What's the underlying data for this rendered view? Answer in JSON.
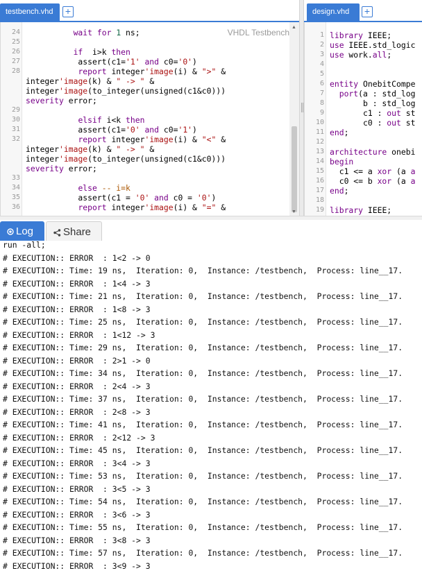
{
  "left_pane": {
    "tab_label": "testbench.vhd",
    "add_tab_symbol": "+",
    "file_label": "VHDL Testbench",
    "lines": [
      {
        "n": "24",
        "segments": [
          [
            "",
            "          "
          ],
          [
            "kw",
            "wait for "
          ],
          [
            "num",
            "1"
          ],
          [
            "",
            " ns;"
          ]
        ]
      },
      {
        "n": "25",
        "segments": []
      },
      {
        "n": "26",
        "segments": [
          [
            "",
            "          "
          ],
          [
            "kw",
            "if "
          ],
          [
            "",
            " i>k "
          ],
          [
            "kw",
            "then"
          ]
        ]
      },
      {
        "n": "27",
        "segments": [
          [
            "",
            "           assert(c1="
          ],
          [
            "str",
            "'1'"
          ],
          [
            "",
            " "
          ],
          [
            "kw",
            "and"
          ],
          [
            "",
            " c0="
          ],
          [
            "str",
            "'0'"
          ],
          [
            "",
            ")"
          ]
        ]
      },
      {
        "n": "28",
        "segments": [
          [
            "",
            "           "
          ],
          [
            "kw",
            "report"
          ],
          [
            "",
            " integer"
          ],
          [
            "str",
            "'image"
          ],
          [
            "",
            "(i) & "
          ],
          [
            "str",
            "\">\""
          ],
          [
            "",
            " &"
          ]
        ]
      },
      {
        "n": "",
        "segments": [
          [
            "",
            "integer"
          ],
          [
            "str",
            "'image"
          ],
          [
            "",
            "(k) & "
          ],
          [
            "str",
            "\" -> \""
          ],
          [
            "",
            " &"
          ]
        ]
      },
      {
        "n": "",
        "segments": [
          [
            "",
            "integer"
          ],
          [
            "str",
            "'image"
          ],
          [
            "",
            "(to_integer(unsigned(c1&c0)))"
          ]
        ]
      },
      {
        "n": "",
        "segments": [
          [
            "kw",
            "severity"
          ],
          [
            "",
            " error;"
          ]
        ]
      },
      {
        "n": "29",
        "segments": []
      },
      {
        "n": "30",
        "segments": [
          [
            "",
            "           "
          ],
          [
            "kw",
            "elsif"
          ],
          [
            "",
            " i<k "
          ],
          [
            "kw",
            "then"
          ]
        ]
      },
      {
        "n": "31",
        "segments": [
          [
            "",
            "           assert(c1="
          ],
          [
            "str",
            "'0'"
          ],
          [
            "",
            " "
          ],
          [
            "kw",
            "and"
          ],
          [
            "",
            " c0="
          ],
          [
            "str",
            "'1'"
          ],
          [
            "",
            ")"
          ]
        ]
      },
      {
        "n": "32",
        "segments": [
          [
            "",
            "           "
          ],
          [
            "kw",
            "report"
          ],
          [
            "",
            " integer"
          ],
          [
            "str",
            "'image"
          ],
          [
            "",
            "(i) & "
          ],
          [
            "str",
            "\"<\""
          ],
          [
            "",
            " &"
          ]
        ]
      },
      {
        "n": "",
        "segments": [
          [
            "",
            "integer"
          ],
          [
            "str",
            "'image"
          ],
          [
            "",
            "(k) & "
          ],
          [
            "str",
            "\" -> \""
          ],
          [
            "",
            " &"
          ]
        ]
      },
      {
        "n": "",
        "segments": [
          [
            "",
            "integer"
          ],
          [
            "str",
            "'image"
          ],
          [
            "",
            "(to_integer(unsigned(c1&c0)))"
          ]
        ]
      },
      {
        "n": "",
        "segments": [
          [
            "kw",
            "severity"
          ],
          [
            "",
            " error;"
          ]
        ]
      },
      {
        "n": "33",
        "segments": []
      },
      {
        "n": "34",
        "segments": [
          [
            "",
            "           "
          ],
          [
            "kw",
            "else"
          ],
          [
            "",
            " "
          ],
          [
            "cmt",
            "-- i=k"
          ]
        ]
      },
      {
        "n": "35",
        "segments": [
          [
            "",
            "           assert(c1 = "
          ],
          [
            "str",
            "'0'"
          ],
          [
            "",
            " "
          ],
          [
            "kw",
            "and"
          ],
          [
            "",
            " c0 = "
          ],
          [
            "str",
            "'0'"
          ],
          [
            "",
            ")"
          ]
        ]
      },
      {
        "n": "36",
        "segments": [
          [
            "",
            "           "
          ],
          [
            "kw",
            "report"
          ],
          [
            "",
            " integer"
          ],
          [
            "str",
            "'image"
          ],
          [
            "",
            "(i) & "
          ],
          [
            "str",
            "\"=\""
          ],
          [
            "",
            " &"
          ]
        ]
      }
    ]
  },
  "right_pane": {
    "tab_label": "design.vhd",
    "add_tab_symbol": "+",
    "lines": [
      {
        "n": "1",
        "segments": [
          [
            "kw",
            "library"
          ],
          [
            "",
            " IEEE;"
          ]
        ]
      },
      {
        "n": "2",
        "segments": [
          [
            "kw",
            "use"
          ],
          [
            "",
            " IEEE.std_logic"
          ]
        ]
      },
      {
        "n": "3",
        "segments": [
          [
            "kw",
            "use"
          ],
          [
            "",
            " work."
          ],
          [
            "kw",
            "all"
          ],
          [
            "",
            ";"
          ]
        ]
      },
      {
        "n": "4",
        "segments": []
      },
      {
        "n": "5",
        "segments": []
      },
      {
        "n": "6",
        "segments": [
          [
            "kw",
            "entity"
          ],
          [
            "",
            " OnebitCompe"
          ]
        ]
      },
      {
        "n": "7",
        "segments": [
          [
            "",
            "  "
          ],
          [
            "kw",
            "port"
          ],
          [
            "",
            "(a : std_log"
          ]
        ]
      },
      {
        "n": "8",
        "segments": [
          [
            "",
            "       b : std_log"
          ]
        ]
      },
      {
        "n": "9",
        "segments": [
          [
            "",
            "       c1 : "
          ],
          [
            "kw",
            "out"
          ],
          [
            "",
            " st"
          ]
        ]
      },
      {
        "n": "10",
        "segments": [
          [
            "",
            "       c0 : "
          ],
          [
            "kw",
            "out"
          ],
          [
            "",
            " st"
          ]
        ]
      },
      {
        "n": "11",
        "segments": [
          [
            "kw",
            "end"
          ],
          [
            "",
            ";"
          ]
        ]
      },
      {
        "n": "12",
        "segments": []
      },
      {
        "n": "13",
        "segments": [
          [
            "kw",
            "architecture"
          ],
          [
            "",
            " onebi"
          ]
        ]
      },
      {
        "n": "14",
        "segments": [
          [
            "kw",
            "begin"
          ]
        ]
      },
      {
        "n": "15",
        "segments": [
          [
            "",
            "  c1 <= a "
          ],
          [
            "kw",
            "xor"
          ],
          [
            "",
            " (a "
          ],
          [
            "kw",
            "a"
          ]
        ]
      },
      {
        "n": "16",
        "segments": [
          [
            "",
            "  c0 <= b "
          ],
          [
            "kw",
            "xor"
          ],
          [
            "",
            " (a "
          ],
          [
            "kw",
            "a"
          ]
        ]
      },
      {
        "n": "17",
        "segments": [
          [
            "kw",
            "end"
          ],
          [
            "",
            ";"
          ]
        ]
      },
      {
        "n": "18",
        "segments": []
      },
      {
        "n": "19",
        "segments": [
          [
            "kw",
            "library"
          ],
          [
            "",
            " IEEE;"
          ]
        ]
      }
    ]
  },
  "bottom_panel": {
    "tabs": [
      {
        "label": "Log",
        "icon": "record-icon",
        "active": true
      },
      {
        "label": "Share",
        "icon": "share-icon",
        "active": false
      }
    ]
  },
  "log": {
    "lines": [
      "run -all;",
      "# EXECUTION:: ERROR  : 1<2 -> 0",
      "# EXECUTION:: Time: 19 ns,  Iteration: 0,  Instance: /testbench,  Process: line__17.",
      "# EXECUTION:: ERROR  : 1<4 -> 3",
      "# EXECUTION:: Time: 21 ns,  Iteration: 0,  Instance: /testbench,  Process: line__17.",
      "# EXECUTION:: ERROR  : 1<8 -> 3",
      "# EXECUTION:: Time: 25 ns,  Iteration: 0,  Instance: /testbench,  Process: line__17.",
      "# EXECUTION:: ERROR  : 1<12 -> 3",
      "# EXECUTION:: Time: 29 ns,  Iteration: 0,  Instance: /testbench,  Process: line__17.",
      "# EXECUTION:: ERROR  : 2>1 -> 0",
      "# EXECUTION:: Time: 34 ns,  Iteration: 0,  Instance: /testbench,  Process: line__17.",
      "# EXECUTION:: ERROR  : 2<4 -> 3",
      "# EXECUTION:: Time: 37 ns,  Iteration: 0,  Instance: /testbench,  Process: line__17.",
      "# EXECUTION:: ERROR  : 2<8 -> 3",
      "# EXECUTION:: Time: 41 ns,  Iteration: 0,  Instance: /testbench,  Process: line__17.",
      "# EXECUTION:: ERROR  : 2<12 -> 3",
      "# EXECUTION:: Time: 45 ns,  Iteration: 0,  Instance: /testbench,  Process: line__17.",
      "# EXECUTION:: ERROR  : 3<4 -> 3",
      "# EXECUTION:: Time: 53 ns,  Iteration: 0,  Instance: /testbench,  Process: line__17.",
      "# EXECUTION:: ERROR  : 3<5 -> 3",
      "# EXECUTION:: Time: 54 ns,  Iteration: 0,  Instance: /testbench,  Process: line__17.",
      "# EXECUTION:: ERROR  : 3<6 -> 3",
      "# EXECUTION:: Time: 55 ns,  Iteration: 0,  Instance: /testbench,  Process: line__17.",
      "# EXECUTION:: ERROR  : 3<8 -> 3",
      "# EXECUTION:: Time: 57 ns,  Iteration: 0,  Instance: /testbench,  Process: line__17.",
      "# EXECUTION:: ERROR  : 3<9 -> 3"
    ]
  },
  "colors": {
    "accent": "#3a7bd5",
    "keyword": "#770088",
    "number": "#116644",
    "string": "#aa1111",
    "comment": "#aa5500"
  }
}
